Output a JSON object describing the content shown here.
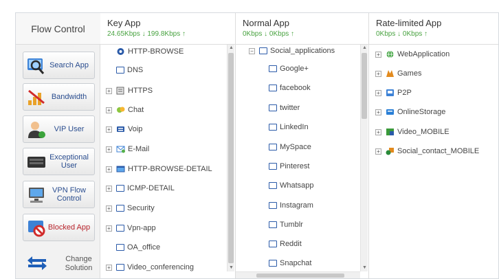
{
  "sidebar": {
    "title": "Flow Control",
    "buttons": [
      {
        "label": "Search App",
        "icon": "search-app-icon"
      },
      {
        "label": "Bandwidth",
        "icon": "bandwidth-icon"
      },
      {
        "label": "VIP User",
        "icon": "vip-user-icon"
      },
      {
        "label": "Exceptional User",
        "icon": "exceptional-user-icon"
      },
      {
        "label": "VPN Flow Control",
        "icon": "vpn-flow-icon"
      },
      {
        "label": "Blocked App",
        "icon": "blocked-app-icon"
      }
    ],
    "change": {
      "label": "Change Solution",
      "icon": "swap-arrows-icon"
    }
  },
  "key_app": {
    "title": "Key App",
    "speed": "24.65Kbps ↓  199.8Kbps ↑",
    "items": [
      {
        "label": "HTTP-BROWSE",
        "icon": "gear-icon",
        "expand": false
      },
      {
        "label": "DNS",
        "icon": "folder-icon",
        "expand": false
      },
      {
        "label": "HTTPS",
        "icon": "document-icon",
        "expand": true
      },
      {
        "label": "Chat",
        "icon": "chat-icon",
        "expand": true
      },
      {
        "label": "Voip",
        "icon": "voip-icon",
        "expand": true
      },
      {
        "label": "E-Mail",
        "icon": "mail-icon",
        "expand": true
      },
      {
        "label": "HTTP-BROWSE-DETAIL",
        "icon": "browser-icon",
        "expand": true
      },
      {
        "label": "ICMP-DETAIL",
        "icon": "folder-icon",
        "expand": true
      },
      {
        "label": "Security",
        "icon": "folder-icon",
        "expand": true
      },
      {
        "label": "Vpn-app",
        "icon": "folder-icon",
        "expand": true
      },
      {
        "label": "OA_office",
        "icon": "folder-icon",
        "expand": false
      },
      {
        "label": "Video_conferencing",
        "icon": "folder-icon",
        "expand": true
      }
    ]
  },
  "normal_app": {
    "title": "Normal App",
    "speed": "0Kbps ↓  0Kbps ↑",
    "group": "Social_applications",
    "items": [
      "Google+",
      "facebook",
      "twitter",
      "LinkedIn",
      "MySpace",
      "Pinterest",
      "Whatsapp",
      "Instagram",
      "Tumblr",
      "Reddit",
      "Snapchat"
    ]
  },
  "rate_app": {
    "title": "Rate-limited App",
    "speed": "0Kbps ↓  0Kbps ↑",
    "items": [
      {
        "label": "WebApplication",
        "icon": "globe-icon"
      },
      {
        "label": "Games",
        "icon": "games-icon"
      },
      {
        "label": "P2P",
        "icon": "p2p-icon"
      },
      {
        "label": "OnlineStorage",
        "icon": "storage-icon"
      },
      {
        "label": "Video_MOBILE",
        "icon": "video-icon"
      },
      {
        "label": "Social_contact_MOBILE",
        "icon": "social-icon"
      }
    ]
  },
  "colors": {
    "accent_blue": "#2a5aa8",
    "speed_green": "#47a23f",
    "blocked_red": "#b8232b"
  }
}
